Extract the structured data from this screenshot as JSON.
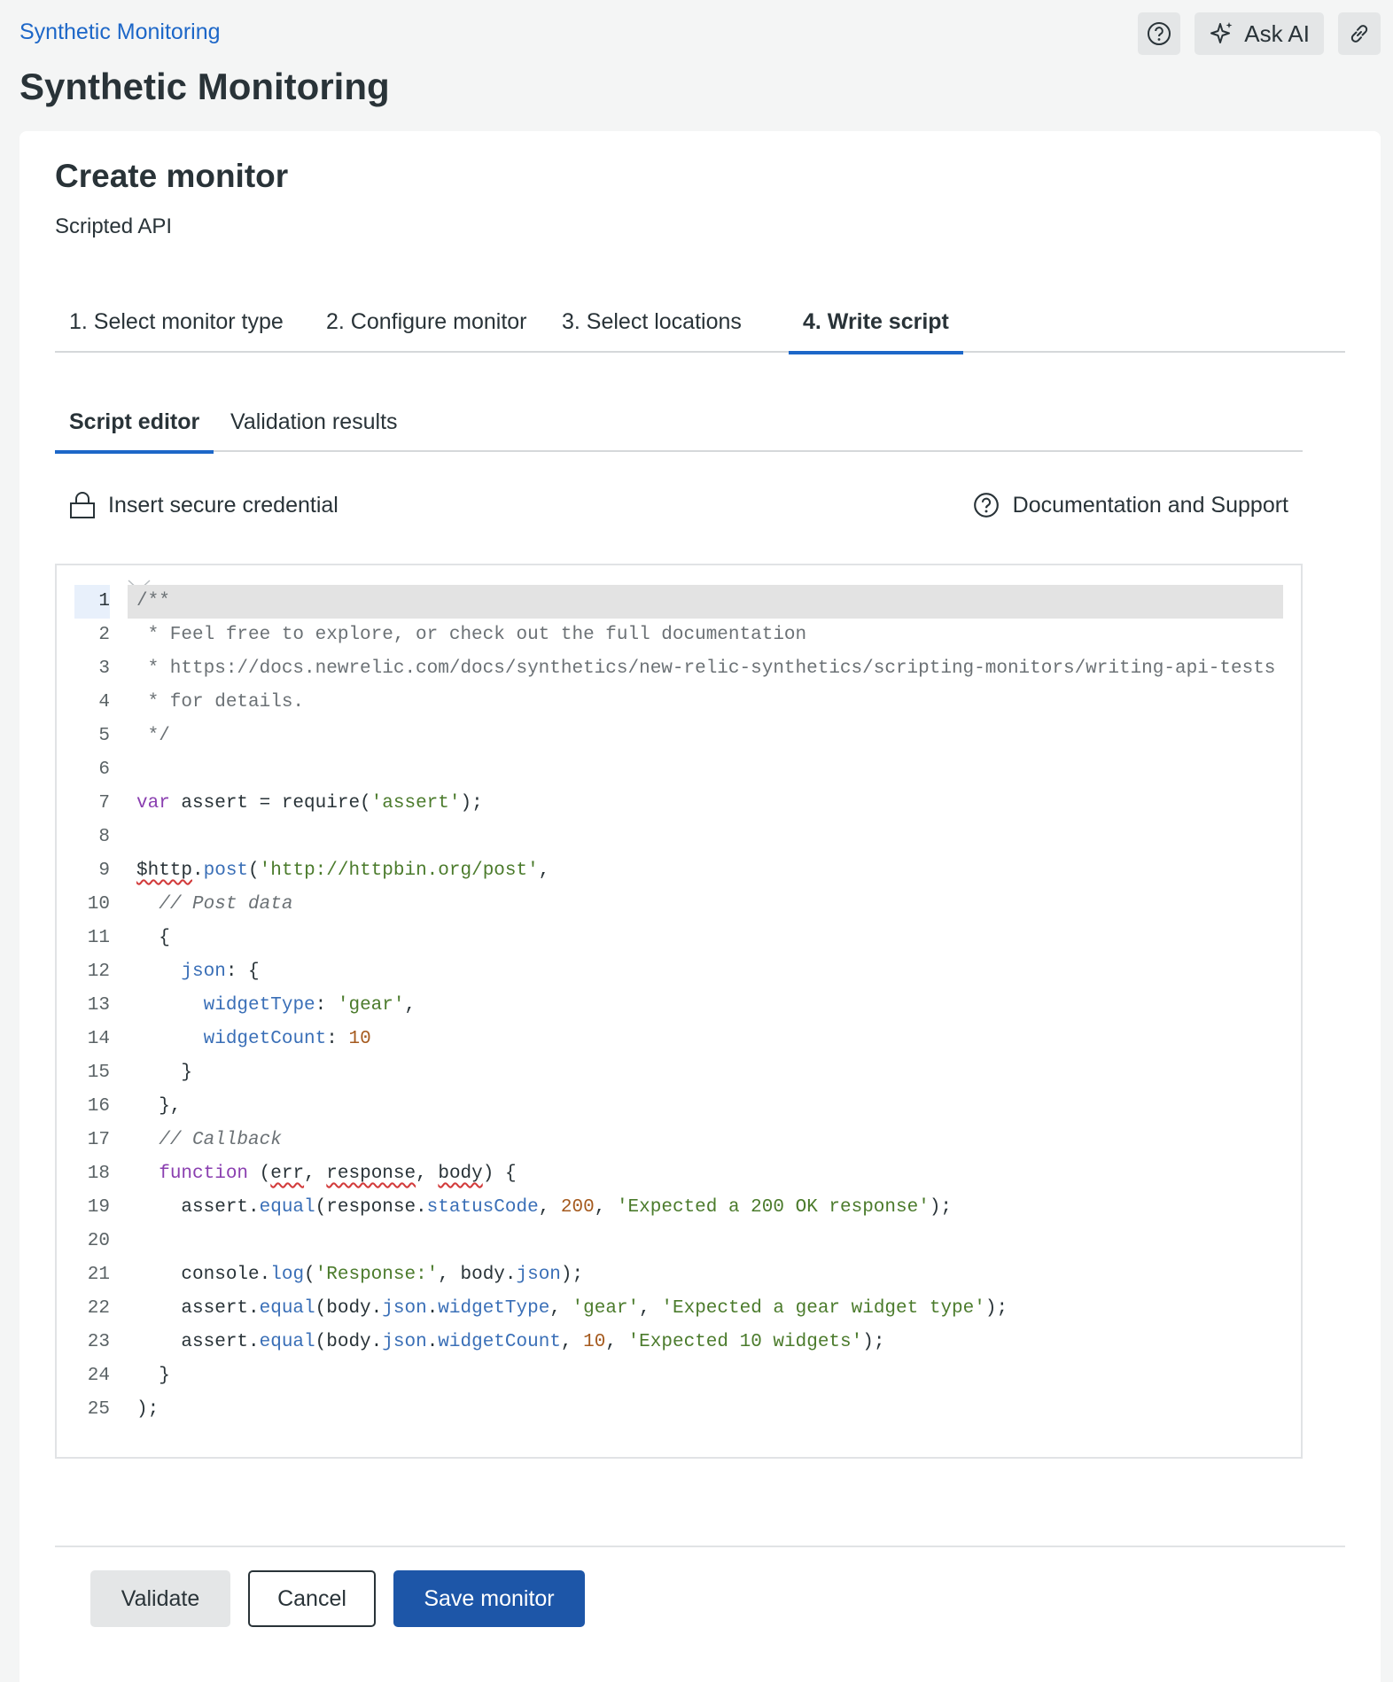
{
  "header": {
    "breadcrumb": "Synthetic Monitoring",
    "title": "Synthetic Monitoring",
    "help_icon": "question-circle-icon",
    "ask_ai_label": "Ask AI",
    "ask_ai_icon": "sparkle-icon",
    "link_icon": "link-icon"
  },
  "card": {
    "title": "Create monitor",
    "subtitle": "Scripted API"
  },
  "steps": [
    {
      "label": "1. Select monitor type"
    },
    {
      "label": "2. Configure monitor"
    },
    {
      "label": "3. Select locations"
    },
    {
      "label": "4. Write script",
      "active": true
    }
  ],
  "subtabs": [
    {
      "label": "Script editor",
      "active": true
    },
    {
      "label": "Validation results"
    }
  ],
  "toolbar": {
    "insert_credential": "Insert secure credential",
    "insert_credential_icon": "lock-icon",
    "docs": "Documentation and Support",
    "docs_icon": "question-circle-icon"
  },
  "editor": {
    "current_line": 1,
    "lines": [
      [
        {
          "t": "/**",
          "c": "doc"
        }
      ],
      [
        {
          "t": " * Feel free to explore, or check out the full documentation",
          "c": "doc"
        }
      ],
      [
        {
          "t": " * https://docs.newrelic.com/docs/synthetics/new-relic-synthetics/scripting-monitors/writing-api-tests",
          "c": "doc"
        }
      ],
      [
        {
          "t": " * for details.",
          "c": "doc"
        }
      ],
      [
        {
          "t": " */",
          "c": "doc"
        }
      ],
      [],
      [
        {
          "t": "var",
          "c": "kw"
        },
        {
          "t": " assert = require("
        },
        {
          "t": "'assert'",
          "c": "str"
        },
        {
          "t": ");"
        }
      ],
      [],
      [
        {
          "t": "$http",
          "c": "err"
        },
        {
          "t": "."
        },
        {
          "t": "post",
          "c": "prop"
        },
        {
          "t": "("
        },
        {
          "t": "'http://httpbin.org/post'",
          "c": "str"
        },
        {
          "t": ","
        }
      ],
      [
        {
          "t": "  "
        },
        {
          "t": "// Post data",
          "c": "comment"
        }
      ],
      [
        {
          "t": "  {"
        }
      ],
      [
        {
          "t": "    "
        },
        {
          "t": "json",
          "c": "prop"
        },
        {
          "t": ": {"
        }
      ],
      [
        {
          "t": "      "
        },
        {
          "t": "widgetType",
          "c": "prop"
        },
        {
          "t": ": "
        },
        {
          "t": "'gear'",
          "c": "str"
        },
        {
          "t": ","
        }
      ],
      [
        {
          "t": "      "
        },
        {
          "t": "widgetCount",
          "c": "prop"
        },
        {
          "t": ": "
        },
        {
          "t": "10",
          "c": "num"
        }
      ],
      [
        {
          "t": "    }"
        }
      ],
      [
        {
          "t": "  },"
        }
      ],
      [
        {
          "t": "  "
        },
        {
          "t": "// Callback",
          "c": "comment"
        }
      ],
      [
        {
          "t": "  "
        },
        {
          "t": "function",
          "c": "kw"
        },
        {
          "t": " ("
        },
        {
          "t": "err",
          "c": "err"
        },
        {
          "t": ", "
        },
        {
          "t": "response",
          "c": "err"
        },
        {
          "t": ", "
        },
        {
          "t": "body",
          "c": "err"
        },
        {
          "t": ") {"
        }
      ],
      [
        {
          "t": "    assert."
        },
        {
          "t": "equal",
          "c": "prop"
        },
        {
          "t": "(response."
        },
        {
          "t": "statusCode",
          "c": "prop"
        },
        {
          "t": ", "
        },
        {
          "t": "200",
          "c": "num"
        },
        {
          "t": ", "
        },
        {
          "t": "'Expected a 200 OK response'",
          "c": "str"
        },
        {
          "t": ");"
        }
      ],
      [],
      [
        {
          "t": "    console."
        },
        {
          "t": "log",
          "c": "prop"
        },
        {
          "t": "("
        },
        {
          "t": "'Response:'",
          "c": "str"
        },
        {
          "t": ", body."
        },
        {
          "t": "json",
          "c": "prop"
        },
        {
          "t": ");"
        }
      ],
      [
        {
          "t": "    assert."
        },
        {
          "t": "equal",
          "c": "prop"
        },
        {
          "t": "(body."
        },
        {
          "t": "json",
          "c": "prop"
        },
        {
          "t": "."
        },
        {
          "t": "widgetType",
          "c": "prop"
        },
        {
          "t": ", "
        },
        {
          "t": "'gear'",
          "c": "str"
        },
        {
          "t": ", "
        },
        {
          "t": "'Expected a gear widget type'",
          "c": "str"
        },
        {
          "t": ");"
        }
      ],
      [
        {
          "t": "    assert."
        },
        {
          "t": "equal",
          "c": "prop"
        },
        {
          "t": "(body."
        },
        {
          "t": "json",
          "c": "prop"
        },
        {
          "t": "."
        },
        {
          "t": "widgetCount",
          "c": "prop"
        },
        {
          "t": ", "
        },
        {
          "t": "10",
          "c": "num"
        },
        {
          "t": ", "
        },
        {
          "t": "'Expected 10 widgets'",
          "c": "str"
        },
        {
          "t": ");"
        }
      ],
      [
        {
          "t": "  }"
        }
      ],
      [
        {
          "t": ");"
        }
      ]
    ]
  },
  "footer": {
    "validate": "Validate",
    "cancel": "Cancel",
    "save": "Save monitor"
  }
}
